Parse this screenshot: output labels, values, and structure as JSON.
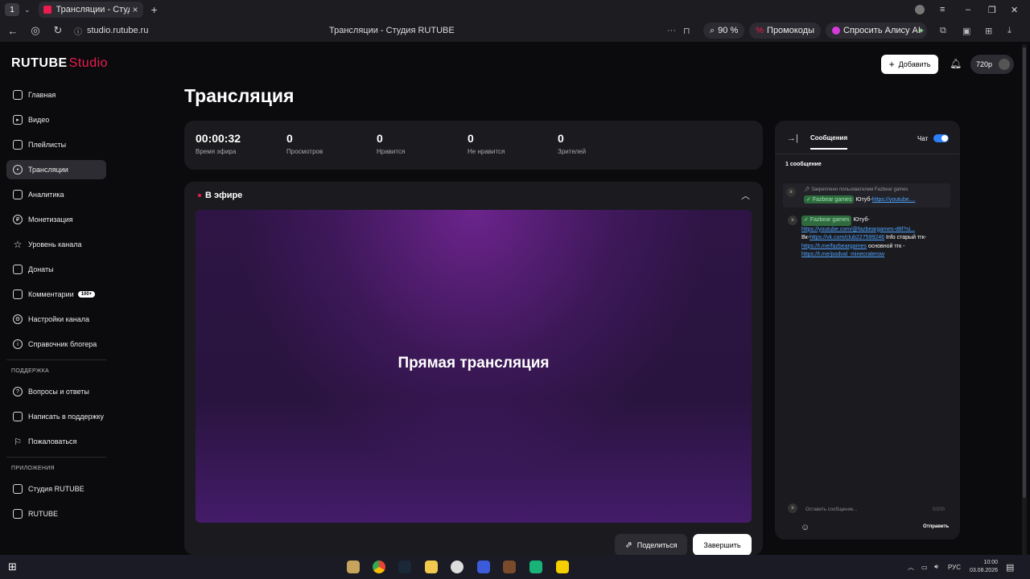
{
  "browser": {
    "tab_number": "1",
    "tab_title": "Трансляции - Студия RUTUBE",
    "url": "studio.rutube.ru",
    "page_title": "Трансляции - Студия RUTUBE",
    "zoom": "90 %",
    "promo_label": "Промокоды",
    "alice_label": "Спросить Алису AI"
  },
  "header": {
    "logo_main": "RUTUBE",
    "logo_studio": "Studio",
    "add_label": "Добавить",
    "quality": "720p"
  },
  "sidebar": {
    "items": [
      {
        "label": "Главная"
      },
      {
        "label": "Видео"
      },
      {
        "label": "Плейлисты"
      },
      {
        "label": "Трансляции"
      },
      {
        "label": "Аналитика"
      },
      {
        "label": "Монетизация"
      },
      {
        "label": "Уровень канала"
      },
      {
        "label": "Донаты"
      },
      {
        "label": "Комментарии",
        "badge": "100+"
      },
      {
        "label": "Настройки канала"
      },
      {
        "label": "Справочник блогера"
      }
    ],
    "support_title": "ПОДДЕРЖКА",
    "support_items": [
      {
        "label": "Вопросы и ответы"
      },
      {
        "label": "Написать в поддержку"
      },
      {
        "label": "Пожаловаться"
      }
    ],
    "apps_title": "ПРИЛОЖЕНИЯ",
    "apps_items": [
      {
        "label": "Студия RUTUBE"
      },
      {
        "label": "RUTUBE"
      }
    ]
  },
  "main": {
    "title": "Трансляция",
    "stats": [
      {
        "value": "00:00:32",
        "label": "Время эфира"
      },
      {
        "value": "0",
        "label": "Просмотров"
      },
      {
        "value": "0",
        "label": "Нравится"
      },
      {
        "value": "0",
        "label": "Не нравится"
      },
      {
        "value": "0",
        "label": "Зрителей"
      }
    ],
    "live_label": "В эфире",
    "video_text": "Прямая трансляция",
    "share_label": "Поделиться",
    "end_label": "Завершить"
  },
  "chat": {
    "tab_label": "Сообщения",
    "chat_label": "Чат",
    "count": "1 сообщение",
    "pinned_note": "Закреплено пользователем Fazbear games",
    "pinned_user": "Fazbear games",
    "pinned_text": "Ютуб-",
    "pinned_link": "https://youtube....",
    "message": {
      "user": "Fazbear games",
      "t1": "Ютуб-",
      "l1": "https://youtube.com/@fazbeargames-d8l?si...",
      "t2": "Вк-",
      "l2": "https://vk.com/club227599246",
      "t3": " Info старый тгк-",
      "l3": "https://t.me/fazbeargames",
      "t4": " основной тгк -",
      "l4": "https://t.me/podval_minecraterow"
    },
    "input_placeholder": "Оставить сообщение...",
    "input_counter": "0/200",
    "send_label": "Отправить"
  },
  "taskbar": {
    "lang": "РУС",
    "time": "10:00",
    "date": "03.08.2026"
  }
}
